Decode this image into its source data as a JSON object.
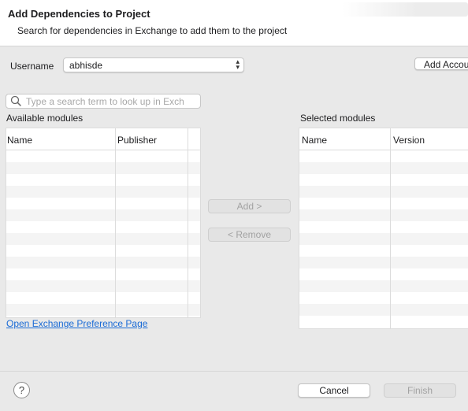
{
  "dialog": {
    "title": "Add Dependencies to Project",
    "description": "Search for dependencies in Exchange to add them to the project"
  },
  "account": {
    "username_label": "Username",
    "username_value": "abhisde",
    "add_account_label": "Add Accou"
  },
  "search": {
    "placeholder": "Type a search term to look up in Excha"
  },
  "available": {
    "label": "Available modules",
    "columns": [
      "Name",
      "Publisher"
    ]
  },
  "selected": {
    "label": "Selected modules",
    "columns": [
      "Name",
      "Version"
    ]
  },
  "actions": {
    "add_label": "Add >",
    "remove_label": "< Remove"
  },
  "links": {
    "preference_page": "Open Exchange Preference Page"
  },
  "footer": {
    "help_symbol": "?",
    "cancel_label": "Cancel",
    "finish_label": "Finish"
  },
  "colors": {
    "link": "#1a6bd6",
    "row_alt": "#f4f4f4"
  }
}
